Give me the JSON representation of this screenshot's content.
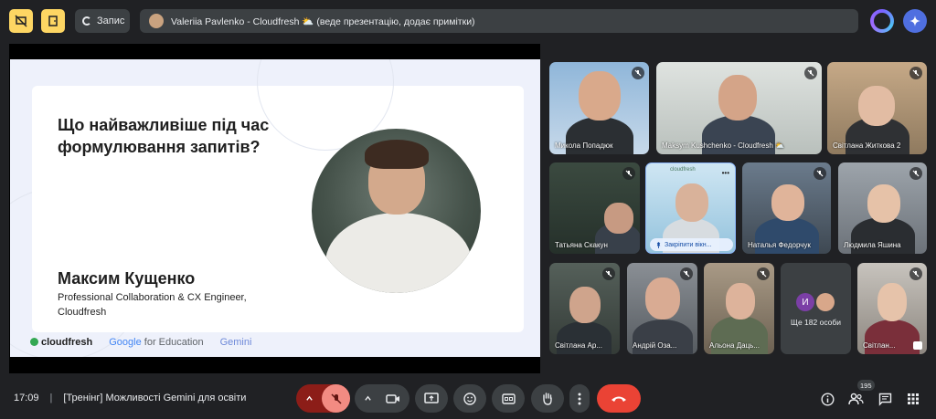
{
  "topbar": {
    "record_label": "Запис",
    "presenter_text": "Valeriia Pavlenko - Cloudfresh ⛅ (веде презентацію, додає примітки)"
  },
  "slide": {
    "title": "Що найважливіше під час формулювання запитів?",
    "speaker_name": "Максим Кущенко",
    "speaker_role_line1": "Professional Collaboration & CX Engineer,",
    "speaker_role_line2": "Cloudfresh",
    "footer_cloudfresh": "cloudfresh",
    "footer_google_g": "Google",
    "footer_google_rest": " for Education",
    "footer_gemini": "Gemini"
  },
  "participants": [
    {
      "name": "Микола Попадюк"
    },
    {
      "name": "Maksym Kushchenko - Cloudfresh ⛅"
    },
    {
      "name": "Світлана Житкова 2"
    },
    {
      "name": "Татьяна Скакун"
    },
    {
      "name": "Закріпити вікн..."
    },
    {
      "name": "Наталья Федорчук"
    },
    {
      "name": "Людмила Яшина"
    },
    {
      "name": "Світлана Ар..."
    },
    {
      "name": "Андрій Оза..."
    },
    {
      "name": "Альона Даць..."
    },
    {
      "name": "Ще 182 особи",
      "initial": "И"
    },
    {
      "name": "Світлан..."
    }
  ],
  "pinned_tile": {
    "logo_text": "cloudfresh",
    "more": "•••"
  },
  "bottombar": {
    "time": "17:09",
    "meeting_title": "[Тренінг] Можливості Gemini для освіти",
    "participants_count": "195"
  },
  "colors": {
    "background": "#202124",
    "panel": "#3c4043",
    "accent_yellow": "#fdd663",
    "end_call": "#ea4335",
    "mic_off": "#8c1d18"
  },
  "icons": [
    "present-off-icon",
    "door-icon",
    "record-spinner-icon",
    "copilot-icon",
    "gemini-icon",
    "mic-off-icon",
    "camera-icon",
    "present-icon",
    "emoji-icon",
    "captions-icon",
    "hand-icon",
    "more-vert-icon",
    "end-call-icon",
    "info-icon",
    "people-icon",
    "chat-icon",
    "apps-icon",
    "pin-icon"
  ]
}
